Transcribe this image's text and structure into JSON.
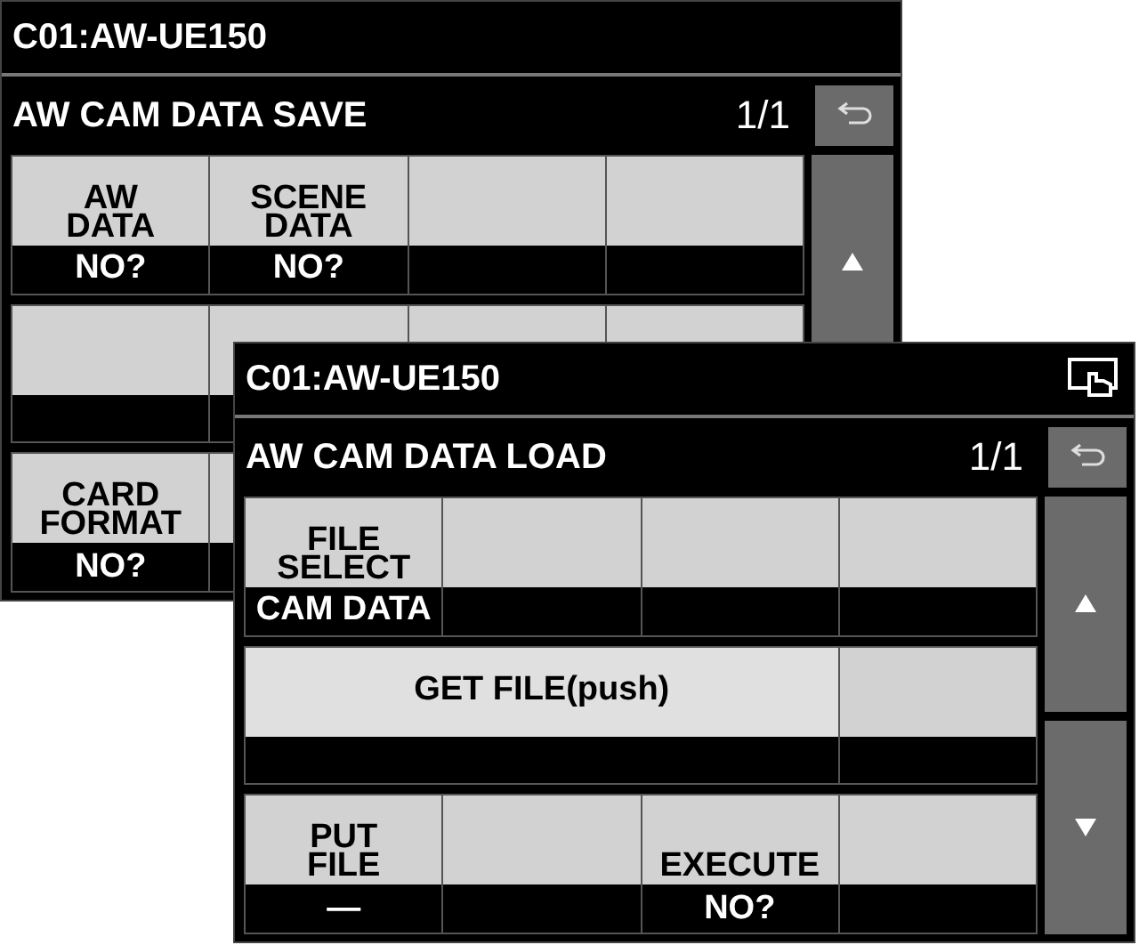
{
  "screens": [
    {
      "title": "C01:AW-UE150",
      "touch_icon": false,
      "heading": "AW CAM DATA SAVE",
      "page": "1/1",
      "scroll_buttons": [
        {
          "kind": "up"
        }
      ],
      "rows": [
        {
          "cells": [
            {
              "kind": "cell",
              "label": "AW\nDATA",
              "value": "NO?"
            },
            {
              "kind": "cell",
              "label": "SCENE\nDATA",
              "value": "NO?"
            },
            {
              "kind": "cell"
            },
            {
              "kind": "cell"
            }
          ]
        },
        {
          "cells": [
            {
              "kind": "cell"
            },
            {
              "kind": "cell"
            },
            {
              "kind": "key-only"
            },
            {
              "kind": "key-only"
            }
          ]
        },
        {
          "cells": [
            {
              "kind": "cell",
              "label": "CARD\nFORMAT",
              "value": "NO?"
            },
            {
              "kind": "cell"
            }
          ]
        }
      ]
    },
    {
      "title": "C01:AW-UE150",
      "touch_icon": true,
      "heading": "AW CAM DATA LOAD",
      "page": "1/1",
      "scroll_buttons": [
        {
          "kind": "up"
        },
        {
          "kind": "down"
        }
      ],
      "rows": [
        {
          "cells": [
            {
              "kind": "cell",
              "label": "FILE\nSELECT",
              "value": "CAM DATA"
            },
            {
              "kind": "cell"
            },
            {
              "kind": "cell"
            },
            {
              "kind": "cell"
            }
          ]
        },
        {
          "cells": [
            {
              "kind": "wide",
              "label": "GET FILE(push)"
            },
            {
              "kind": "cell"
            }
          ]
        },
        {
          "cells": [
            {
              "kind": "cell",
              "label": "PUT\nFILE",
              "value": "—"
            },
            {
              "kind": "cell"
            },
            {
              "kind": "cell",
              "label": "EXECUTE",
              "value": "NO?"
            },
            {
              "kind": "cell"
            }
          ]
        }
      ]
    }
  ]
}
